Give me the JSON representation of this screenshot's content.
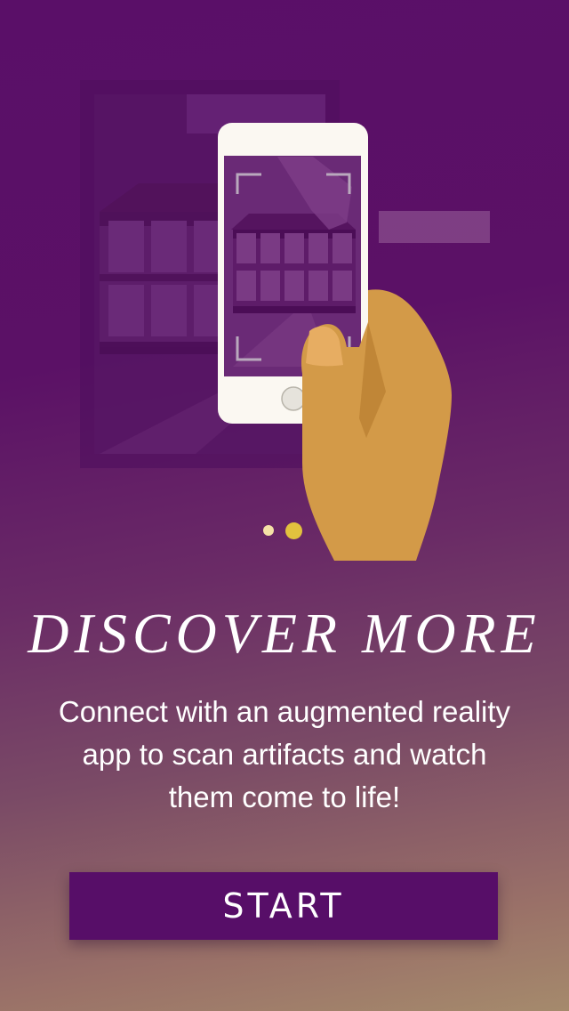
{
  "onboarding": {
    "illustration_icons": [
      "building-icon",
      "smartphone-icon",
      "hand-icon",
      "scan-frame-icon"
    ],
    "pager": {
      "total": 2,
      "active": 2
    },
    "headline": "DISCOVER MORE",
    "description": "Connect with an augmented reality app to scan artifacts and watch them come to life!",
    "start_button_label": "START"
  },
  "colors": {
    "background_top": "#5a0f68",
    "background_bottom": "#a58a6c",
    "button": "#570e68",
    "dot_inactive": "#f4e2a6",
    "dot_active": "#e2c23e",
    "hand": "#d39a48"
  }
}
